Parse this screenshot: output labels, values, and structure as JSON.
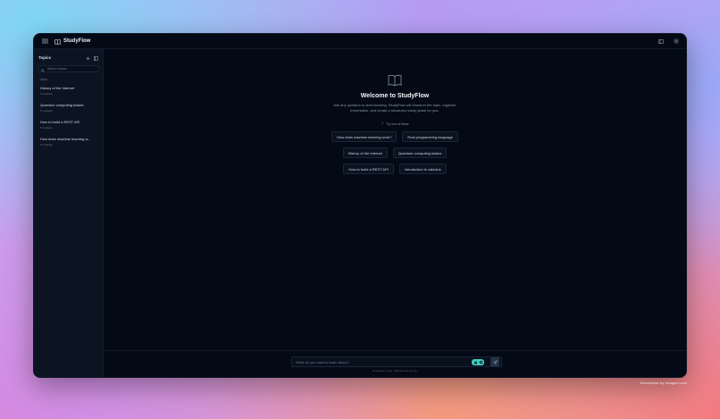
{
  "app": {
    "title": "StudyFlow"
  },
  "sidebar": {
    "title": "Topics",
    "search_placeholder": "Search topics...",
    "section_label": "Topics",
    "items": [
      {
        "title": "History of the Internet",
        "subtitle": "5 modules"
      },
      {
        "title": "Quantum computing basics",
        "subtitle": "5 modules"
      },
      {
        "title": "How to build a REST API",
        "subtitle": "5 modules"
      },
      {
        "title": "How does machine learning w...",
        "subtitle": "5 modules"
      }
    ]
  },
  "welcome": {
    "title": "Welcome to StudyFlow",
    "description": "Ask any question to start learning. StudyFlow will research the topic, organize information, and create a structured study guide for you.",
    "try_label": "Try one of these",
    "suggestions_row1": [
      "How does machine learning work?",
      "Rust programming language"
    ],
    "suggestions_row2": [
      "History of the Internet",
      "Quantum computing basics"
    ],
    "suggestions_row3": [
      "How to build a REST API",
      "Introduction to calculus"
    ]
  },
  "composer": {
    "placeholder": "What do you want to learn about?",
    "hint": "Press Enter to send · Shift+Enter for new line"
  },
  "watermark": "Screenshot by Xnapper.com",
  "icons": {
    "menu": "menu-icon",
    "brand": "open-book-icon",
    "layout": "panel-icon",
    "settings": "gear-icon",
    "add": "plus-icon",
    "sidebar_toggle": "sidebar-icon",
    "search": "search-icon",
    "try": "sparkle-icon",
    "send": "send-icon"
  },
  "colors": {
    "window_bg": "#030915",
    "sidebar_bg": "#0c1422",
    "accent_badge": "#40d0c0"
  }
}
